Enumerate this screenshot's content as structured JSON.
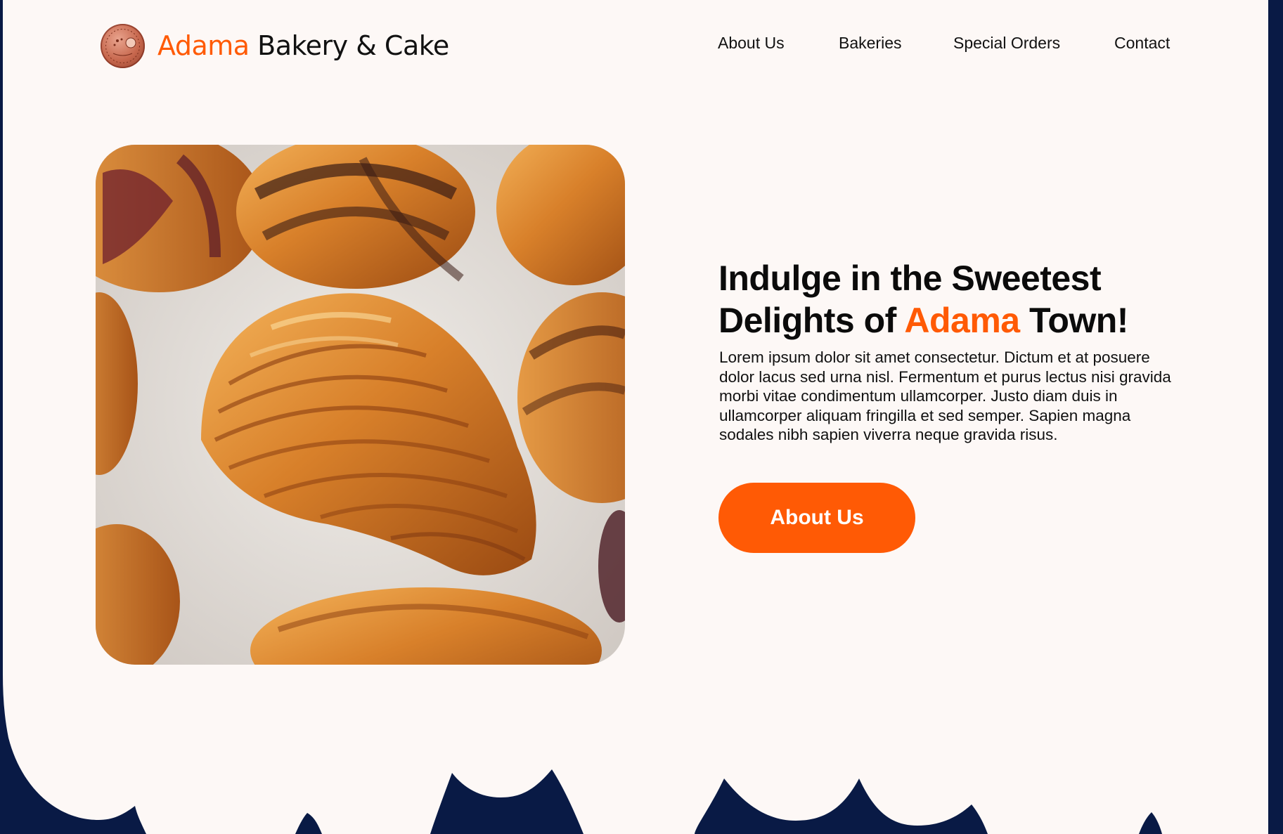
{
  "brand": {
    "name_accent": "Adama",
    "name_rest": "Bakery & Cake",
    "logo_icon": "bakery-logo-badge"
  },
  "nav": {
    "items": [
      {
        "label": "About Us"
      },
      {
        "label": "Bakeries"
      },
      {
        "label": "Special Orders"
      },
      {
        "label": "Contact"
      }
    ]
  },
  "hero": {
    "image_label": "croissants",
    "headline_line1": "Indulge in the Sweetest",
    "headline_prefix": "Delights of ",
    "headline_accent": "Adama",
    "headline_suffix": " Town!",
    "body": "Lorem ipsum dolor sit amet consectetur. Dictum et at posuere dolor lacus sed urna nisl. Fermentum et purus lectus nisi gravida morbi vitae condimentum ullamcorper. Justo diam duis in ullamcorper aliquam fringilla et sed semper. Sapien magna sodales nibh sapien viverra neque gravida risus.",
    "cta_label": "About Us"
  },
  "colors": {
    "accent": "#ff5a05",
    "background": "#fdf8f6",
    "navy": "#091a45",
    "text": "#111111"
  }
}
